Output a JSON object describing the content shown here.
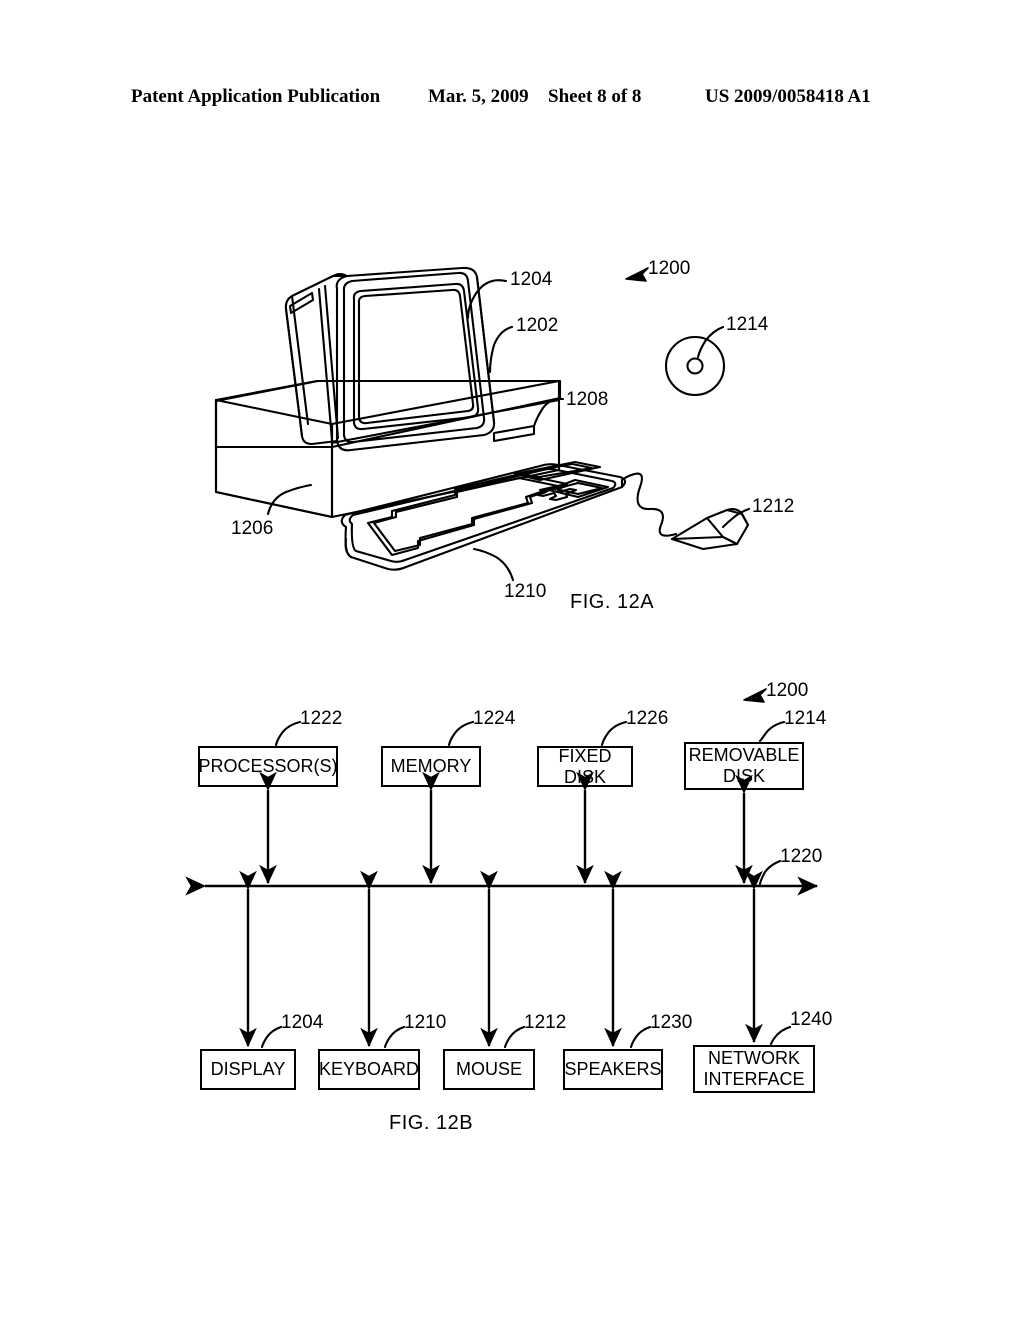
{
  "header": {
    "publication": "Patent Application Publication",
    "date": "Mar. 5, 2009",
    "sheet": "Sheet 8 of 8",
    "patent_number": "US 2009/0058418 A1"
  },
  "figures": [
    {
      "caption": "FIG. 12A",
      "type": "perspective-drawing",
      "description": "Computer system perspective view",
      "refs": {
        "system": "1200",
        "monitor_housing": "1202",
        "display_screen": "1204",
        "chassis": "1206",
        "drive_slot": "1208",
        "keyboard": "1210",
        "mouse": "1212",
        "removable_disk": "1214"
      }
    },
    {
      "caption": "FIG. 12B",
      "type": "block-diagram",
      "description": "Computer system block diagram",
      "refs": {
        "system": "1200",
        "bus": "1220"
      }
    }
  ],
  "fig12a": {
    "caption": "FIG. 12A",
    "labels": {
      "system": "1200",
      "screen": "1204",
      "monitor": "1202",
      "drive_slot": "1208",
      "chassis": "1206",
      "keyboard": "1210",
      "mouse": "1212",
      "disk": "1214"
    }
  },
  "fig12b": {
    "caption": "FIG. 12B",
    "system_label": "1200",
    "bus_label": "1220",
    "top_boxes": [
      {
        "label": "PROCESSOR(S)",
        "ref": "1222"
      },
      {
        "label": "MEMORY",
        "ref": "1224"
      },
      {
        "label": "FIXED DISK",
        "ref": "1226"
      },
      {
        "label": "REMOVABLE\nDISK",
        "ref": "1214"
      }
    ],
    "bottom_boxes": [
      {
        "label": "DISPLAY",
        "ref": "1204"
      },
      {
        "label": "KEYBOARD",
        "ref": "1210"
      },
      {
        "label": "MOUSE",
        "ref": "1212"
      },
      {
        "label": "SPEAKERS",
        "ref": "1230"
      },
      {
        "label": "NETWORK\nINTERFACE",
        "ref": "1240"
      }
    ]
  }
}
